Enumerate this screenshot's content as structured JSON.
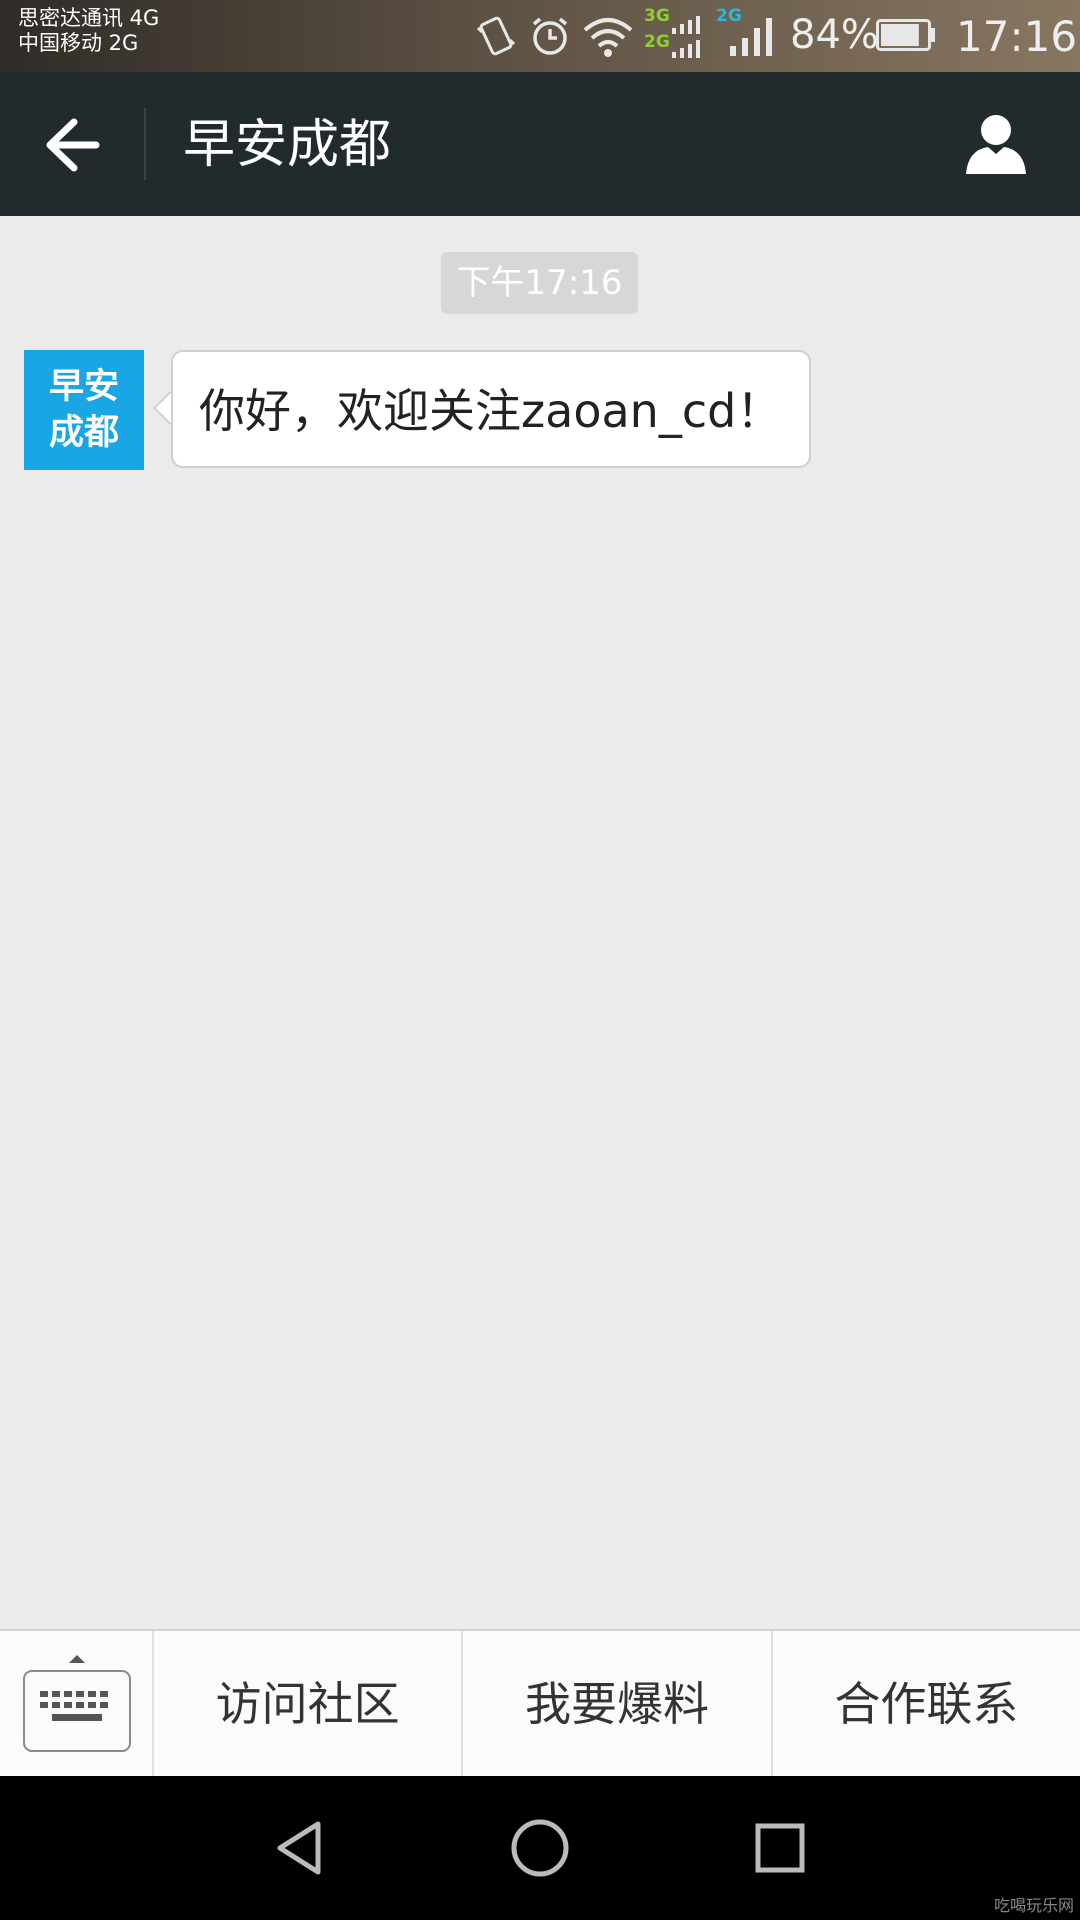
{
  "status_bar": {
    "carrier_1": "思密达通讯  4G",
    "carrier_2": "中国移动  2G",
    "sim1_network": "3G",
    "sim1_network_2": "2G",
    "sim2_network": "2G",
    "battery_percent": "84%",
    "battery_level": 0.84,
    "time": "17:16",
    "icons": [
      "vibrate-icon",
      "alarm-icon",
      "wifi-icon",
      "signal-icon",
      "signal-icon",
      "battery-icon"
    ]
  },
  "header": {
    "title": "早安成都",
    "back_icon": "arrow-left-icon",
    "profile_icon": "person-icon"
  },
  "chat": {
    "timestamp": "下午17:16",
    "avatar_text": [
      "早安",
      "成都"
    ],
    "avatar_color": "#1aa6e4",
    "messages": [
      {
        "sender": "早安成都",
        "text": "你好，欢迎关注zaoan_cd！"
      }
    ]
  },
  "menu": {
    "keyboard_icon": "keyboard-icon",
    "items": [
      {
        "label": "访问社区"
      },
      {
        "label": "我要爆料"
      },
      {
        "label": "合作联系"
      }
    ]
  },
  "nav": {
    "icons": [
      "back-triangle-icon",
      "home-circle-icon",
      "recents-square-icon"
    ],
    "watermark": "吃喝玩乐网"
  },
  "colors": {
    "action_bar": "#212b2e",
    "background": "#ebebeb",
    "network_green": "#8fcf2a",
    "network_cyan": "#2ab8d8"
  }
}
